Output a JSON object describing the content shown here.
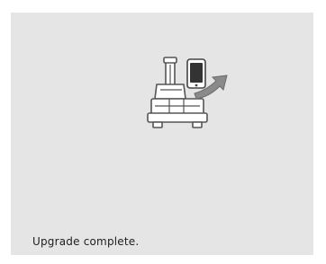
{
  "screen": {
    "status_message": "Upgrade complete.",
    "background_color": "#e5e5e5",
    "illustration": {
      "icon": "machine-with-phone-upgrade-icon"
    }
  }
}
